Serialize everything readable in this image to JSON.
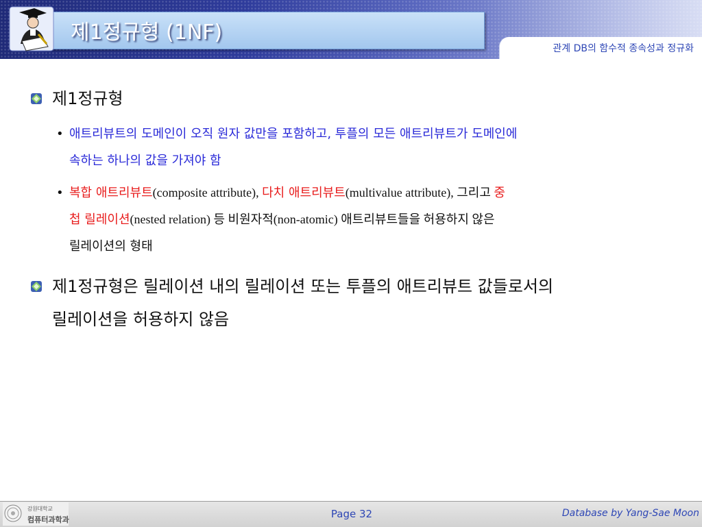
{
  "header": {
    "title": "제1정규형 (1NF)",
    "subtitle": "관계 DB의 함수적 종속성과 정규화"
  },
  "body": {
    "bullet1": {
      "text": "제1정규형",
      "sub1": {
        "line1": "애트리뷰트의 도메인이 오직 원자 값만을 포함하고, 투플의 모든 애트리뷰트가 도메인에",
        "line2": "속하는 하나의 값을 가져야 함"
      },
      "sub2": {
        "l1_a": "복합 애트리뷰트",
        "l1_b": "(composite attribute), ",
        "l1_c": "다치 애트리뷰트",
        "l1_d": "(multivalue attribute), 그리고 ",
        "l1_e": "중",
        "l2_a": "첩 릴레이션",
        "l2_b": "(nested relation) 등 비원자적(non-atomic) 애트리뷰트들을 허용하지 않은",
        "l3": "릴레이션의 형태"
      }
    },
    "bullet2": {
      "line1": "제1정규형은 릴레이션 내의 릴레이션 또는 투플의 애트리뷰트 값들로서의",
      "line2": "릴레이션을 허용하지 않음"
    }
  },
  "footer": {
    "university_small": "강원대학교",
    "department": "컴퓨터과학과",
    "page": "Page 32",
    "credit": "Database by Yang-Sae Moon"
  },
  "icons": {
    "bullet": "green-blue-gem-icon",
    "header": "scholar-writing-icon",
    "footer": "university-seal-icon"
  },
  "colors": {
    "header_dark": "#1f2a78",
    "title_box": "#a3c7ee",
    "accent_blue": "#2a2ad8",
    "accent_red": "#e81c1c",
    "footer_text": "#2d46b5"
  }
}
